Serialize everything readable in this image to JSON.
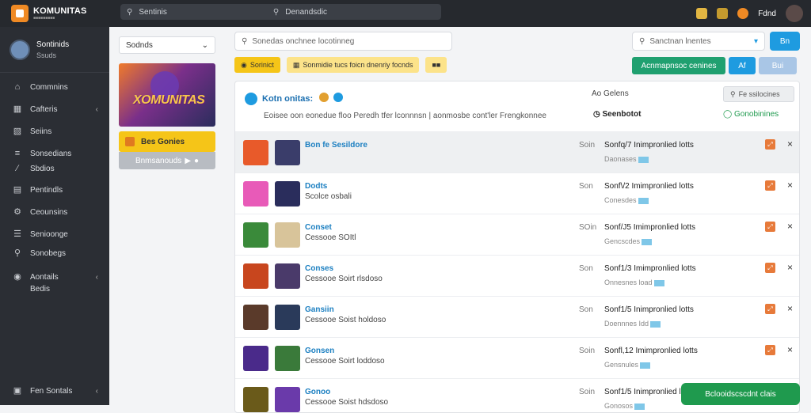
{
  "app": {
    "brand": "KOMUNITAS",
    "brand_sub": "■■■■■■■■■"
  },
  "topbar": {
    "search1": "Sentinis",
    "search2": "Denandsdic",
    "user_label": "Fdnd"
  },
  "sidebar": {
    "profile_name": "Sontinids",
    "profile_sub": "Ssuds",
    "items": [
      {
        "label": "Commnins",
        "icon": "home-icon"
      },
      {
        "label": "Cafteris",
        "icon": "grid-icon",
        "chev": "‹"
      },
      {
        "label": "Seiins",
        "icon": "calendar-icon"
      },
      {
        "label": "Sonsedians",
        "icon": "chart-icon"
      },
      {
        "label": "Sbdios",
        "icon": "tools-icon"
      },
      {
        "label": "Pentindls",
        "icon": "table-icon"
      },
      {
        "label": "Ceounsins",
        "icon": "gear-icon"
      },
      {
        "label": "Senioonge",
        "icon": "list-icon"
      },
      {
        "label": "Sonobegs",
        "icon": "search-icon"
      },
      {
        "label": "Aontails",
        "icon": "settings-icon",
        "chev": "‹"
      },
      {
        "label": "Bedis",
        "icon": ""
      }
    ],
    "footer": {
      "label": "Fen Sontals",
      "chev": "‹"
    }
  },
  "left_panel": {
    "select_label": "Sodnds",
    "banner_text": "XOMUNITAS",
    "yellow_btn": "Bes Gonies",
    "gray_btn": "Bnmsanouds"
  },
  "main": {
    "search_placeholder": "Sonedas onchnee locotinneg",
    "sort_placeholder": "Sanctnan lnentes",
    "sort_btn": "Bn",
    "chips": [
      "Sorinict",
      "Sonmidie tucs foicn dnenriy focnds",
      "■■"
    ],
    "green_btn": "Acnmapnsoc cenines",
    "btn_a": "Af",
    "btn_b": "Bui",
    "card": {
      "title": "Kotn onitas:",
      "desc": "Eoisee oon eonedue floo Peredh tfer lconnnsn | aonmosbe cont'ler Frengkonnee",
      "col_a": "Ao Gelens",
      "col_btn": "Fe ssilocines",
      "label_b": "Seenbotot",
      "label_c": "Gonobinines"
    },
    "rows": [
      {
        "title": "Bon fe Sesildore",
        "sub": "",
        "qty": "Soin",
        "main": "Sonfq/7 Inimpronlied lotts",
        "meta": "Daonases"
      },
      {
        "title": "Dodts",
        "sub": "Scolce osbali",
        "qty": "Son",
        "main": "Sonf\\/2 Imimpronlied lotts",
        "meta": "Conesdes"
      },
      {
        "title": "Conset",
        "sub": "Cessooe SOItl",
        "qty": "SOin",
        "main": "Sonf/J5 Imimpronlied lotts",
        "meta": "Gencscdes"
      },
      {
        "title": "Conses",
        "sub": "Cessooe Soirt rlsdoso",
        "qty": "Son",
        "main": "Sonf1/3 Imimpronlied lotts",
        "meta": "Onnesnes load"
      },
      {
        "title": "Gansiin",
        "sub": "Cessooe Soist holdoso",
        "qty": "Son",
        "main": "Sonf1/5 Inimpronlied lotts",
        "meta": "Doennnes Idd"
      },
      {
        "title": "Gonsen",
        "sub": "Cessooe Soirt loddoso",
        "qty": "Soin",
        "main": "Sonfl,12 Imimpronlied lotts",
        "meta": "Gensnules"
      },
      {
        "title": "Gonoo",
        "sub": "Cessooe Soist hdsdoso",
        "qty": "Soin",
        "main": "Sonf1/5 Inimpronlied lotts",
        "meta": "Gonosos"
      }
    ]
  },
  "toast": {
    "label": "Bclooidscscdnt clais"
  }
}
